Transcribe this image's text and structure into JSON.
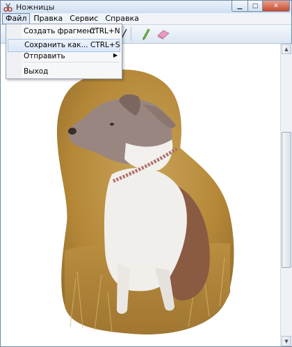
{
  "window": {
    "title": "Ножницы"
  },
  "menubar": {
    "items": [
      "Файл",
      "Правка",
      "Сервис",
      "Справка"
    ]
  },
  "file_menu": {
    "items": [
      {
        "label": "Создать фрагмент",
        "shortcut": "CTRL+N"
      },
      {
        "label": "Сохранить как...",
        "shortcut": "CTRL+S"
      },
      {
        "label": "Отправить",
        "shortcut": ""
      },
      {
        "label": "Выход",
        "shortcut": ""
      }
    ]
  },
  "toolbar": {
    "icons": [
      "pen-icon",
      "highlighter-icon",
      "eraser-icon"
    ]
  },
  "colors": {
    "accent": "#6b8bb5",
    "highlighter": "#7cc242",
    "eraser": "#e79bc0"
  }
}
